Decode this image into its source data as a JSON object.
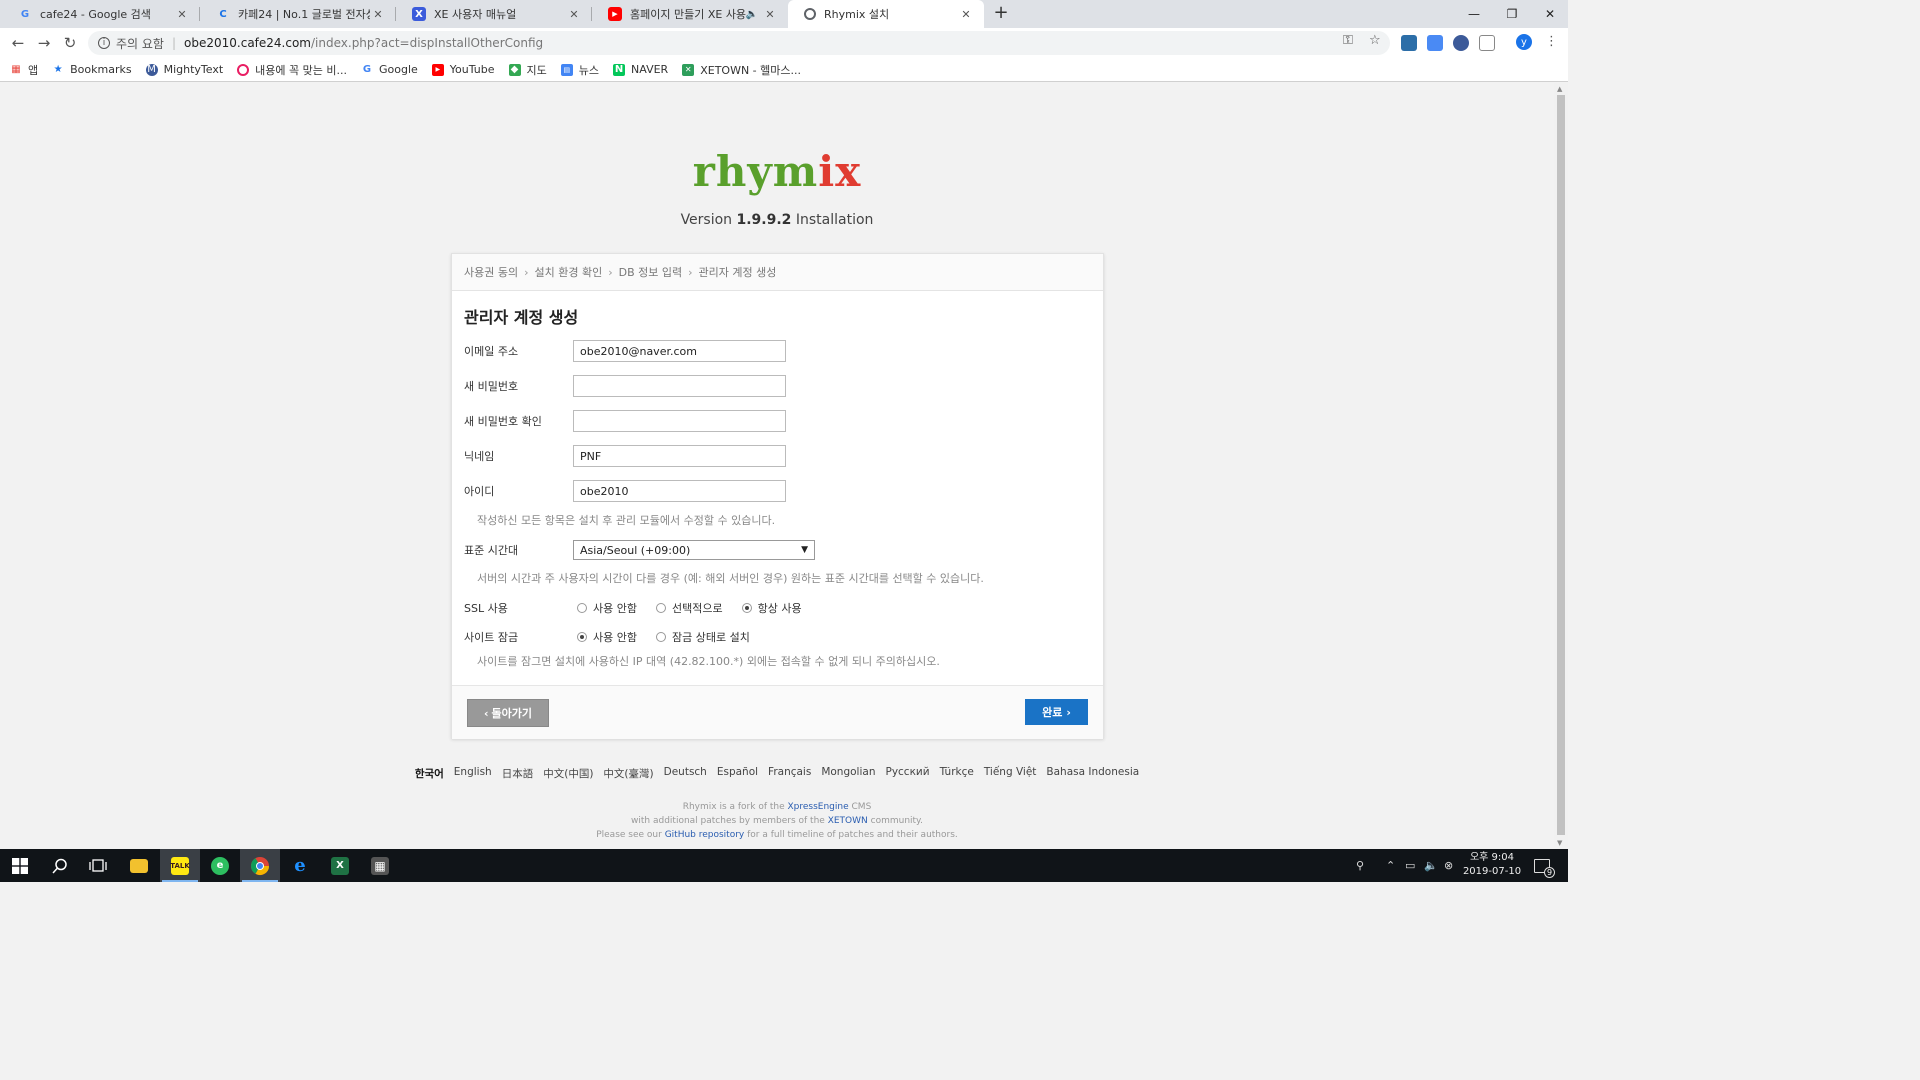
{
  "browser": {
    "tabs": [
      {
        "title": "cafe24 - Google 검색",
        "icon": "google-icon",
        "color": "#4285f4",
        "glyph": "G"
      },
      {
        "title": "카페24 | No.1 글로벌 전자상거래",
        "icon": "cafe24-icon",
        "color": "#1a73e8",
        "glyph": "C"
      },
      {
        "title": "XE 사용자 매뉴얼",
        "icon": "xe-icon",
        "color": "#3b5bdb",
        "glyph": "X"
      },
      {
        "title": "홈페이지 만들기 XE 사용법",
        "icon": "youtube-icon",
        "color": "#ff0000",
        "glyph": "▶"
      },
      {
        "title": "Rhymix 설치",
        "icon": "globe-icon",
        "color": "#5f6368",
        "glyph": "◉"
      }
    ],
    "address": {
      "warning": "주의 요함",
      "host": "obe2010.cafe24.com",
      "path": "/index.php?act=dispInstallOtherConfig"
    },
    "bookmarks": [
      {
        "label": "앱",
        "icon": "apps-icon",
        "color": "#e8453c"
      },
      {
        "label": "Bookmarks",
        "icon": "star-icon",
        "color": "#1a73e8"
      },
      {
        "label": "MightyText",
        "icon": "mightytext-icon",
        "color": "#3c5a99"
      },
      {
        "label": "내용에 꼭 맞는 비...",
        "icon": "circle-icon",
        "color": "#e91e63"
      },
      {
        "label": "Google",
        "icon": "google-icon",
        "color": "#4285f4"
      },
      {
        "label": "YouTube",
        "icon": "youtube-icon",
        "color": "#ff0000"
      },
      {
        "label": "지도",
        "icon": "maps-icon",
        "color": "#34a853"
      },
      {
        "label": "뉴스",
        "icon": "news-icon",
        "color": "#4285f4"
      },
      {
        "label": "NAVER",
        "icon": "naver-icon",
        "color": "#03c75a"
      },
      {
        "label": "XETOWN - 헬마스...",
        "icon": "xetown-icon",
        "color": "#2e9e5b"
      }
    ]
  },
  "installer": {
    "logo_left": "rhym",
    "logo_right": "ix",
    "version_prefix": "Version ",
    "version": "1.9.9.2",
    "version_suffix": " Installation",
    "breadcrumb": [
      "사용권 동의",
      "설치 환경 확인",
      "DB 정보 입력",
      "관리자 계정 생성"
    ],
    "title": "관리자 계정 생성",
    "fields": {
      "email": {
        "label": "이메일 주소",
        "value": "obe2010@naver.com"
      },
      "password": {
        "label": "새 비밀번호",
        "value": ""
      },
      "password_confirm": {
        "label": "새 비밀번호 확인",
        "value": ""
      },
      "nickname": {
        "label": "닉네임",
        "value": "PNF"
      },
      "user_id": {
        "label": "아이디",
        "value": "obe2010"
      }
    },
    "fields_help": "작성하신 모든 항목은 설치 후 관리 모듈에서 수정할 수 있습니다.",
    "timezone": {
      "label": "표준 시간대",
      "value": "Asia/Seoul (+09:00)"
    },
    "timezone_help": "서버의 시간과 주 사용자의 시간이 다를 경우 (예: 해외 서버인 경우) 원하는 표준 시간대를 선택할 수 있습니다.",
    "ssl": {
      "label": "SSL 사용",
      "options": [
        "사용 안함",
        "선택적으로",
        "항상 사용"
      ],
      "selected": "항상 사용"
    },
    "lock": {
      "label": "사이트 잠금",
      "options": [
        "사용 안함",
        "잠금 상태로 설치"
      ],
      "selected": "사용 안함"
    },
    "lock_help": "사이트를 잠그면 설치에 사용하신 IP 대역 (42.82.100.*) 외에는 접속할 수 없게 되니 주의하십시오.",
    "back_label": "돌아가기",
    "done_label": "완료",
    "languages": [
      "한국어",
      "English",
      "日本語",
      "中文(中国)",
      "中文(臺灣)",
      "Deutsch",
      "Español",
      "Français",
      "Mongolian",
      "Русский",
      "Türkçe",
      "Tiếng Việt",
      "Bahasa Indonesia"
    ],
    "current_language": "한국어",
    "credits": {
      "line1_a": "Rhymix is a fork of the ",
      "line1_link": "XpressEngine",
      "line1_b": " CMS",
      "line2_a": "with additional patches by members of the ",
      "line2_link": "XETOWN",
      "line2_b": " community.",
      "line3_a": "Please see our ",
      "line3_link": "GitHub repository",
      "line3_b": " for a full timeline of patches and their authors."
    }
  },
  "taskbar": {
    "apps": [
      {
        "name": "start-icon"
      },
      {
        "name": "search-icon"
      },
      {
        "name": "task-view-icon"
      },
      {
        "name": "file-explorer-icon",
        "color": "#f2c12e"
      },
      {
        "name": "kakaotalk-icon",
        "color": "#ffe812"
      },
      {
        "name": "evernote-icon",
        "color": "#2dbe60"
      },
      {
        "name": "chrome-icon",
        "color": "#4285f4"
      },
      {
        "name": "edge-icon",
        "color": "#1e90ff"
      },
      {
        "name": "excel-icon",
        "color": "#1f7244"
      },
      {
        "name": "calculator-icon",
        "color": "#555555"
      }
    ],
    "clock_period": "오후 9:04",
    "date": "2019-07-10",
    "notification_count": "9"
  }
}
